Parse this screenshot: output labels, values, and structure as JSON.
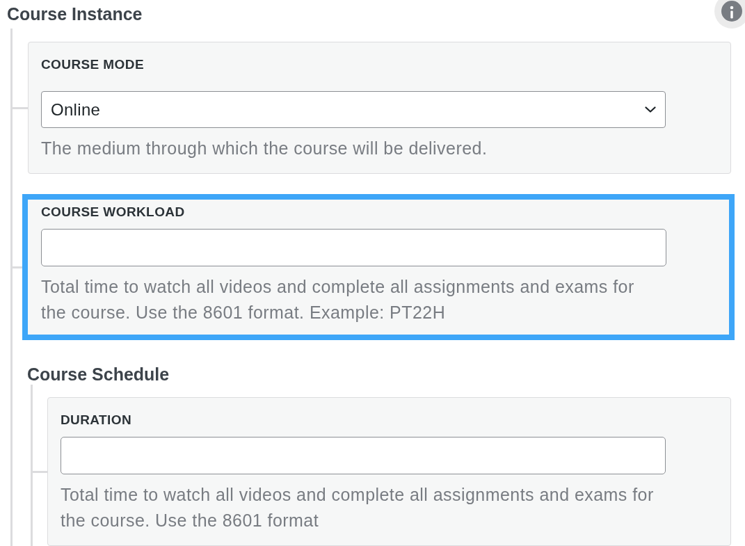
{
  "sections": [
    {
      "title": "Course Instance",
      "fields": [
        {
          "kind": "select",
          "label": "COURSE MODE",
          "value": "Online",
          "help": "The medium through which the course will be delivered.",
          "highlighted": false
        },
        {
          "kind": "text",
          "label": "COURSE WORKLOAD",
          "help": "Total time to watch all videos and complete all assignments and exams for the course. Use the 8601 format. Example: PT22H",
          "highlighted": true
        }
      ],
      "subsections": [
        {
          "title": "Course Schedule",
          "fields": [
            {
              "kind": "text",
              "label": "DURATION",
              "help": "Total time to watch all videos and complete all assignments and exams for the course. Use the 8601 format",
              "highlighted": false
            }
          ]
        }
      ]
    }
  ]
}
